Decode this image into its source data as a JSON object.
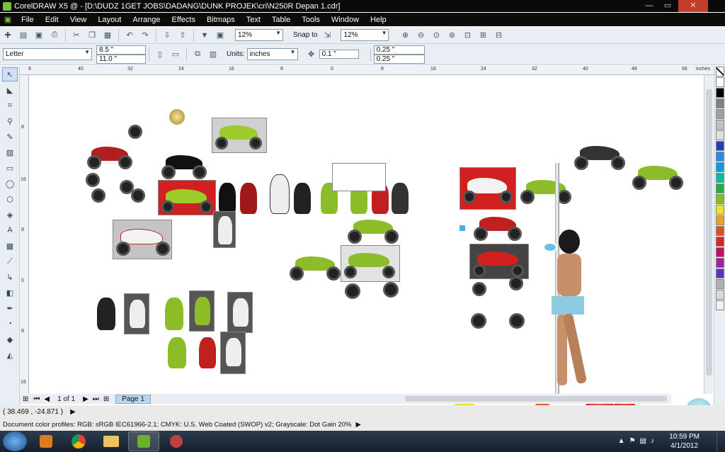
{
  "window": {
    "title": "CorelDRAW X5 @ - [D:\\DUDZ 1GET JOBS\\DADANG\\DUNK PROJEK\\cri\\N250R Depan 1.cdr]",
    "minimize": "—",
    "maximize": "▭",
    "close": "✕"
  },
  "menu": [
    "File",
    "Edit",
    "View",
    "Layout",
    "Arrange",
    "Effects",
    "Bitmaps",
    "Text",
    "Table",
    "Tools",
    "Window",
    "Help"
  ],
  "standard_toolbar": {
    "zoom_value": "12%",
    "snap_to_label": "Snap to",
    "zoom_value_2": "12%"
  },
  "property_bar": {
    "page_size": "Letter",
    "width": "8.5 \"",
    "height": "11.0 \"",
    "units_label": "Units:",
    "units_value": "inches",
    "nudge": "0.1 \"",
    "dup_x": "0.25 \"",
    "dup_y": "0.25 \""
  },
  "ruler": {
    "h_ticks": [
      "8",
      "40",
      "32",
      "24",
      "16",
      "8",
      "0",
      "8",
      "16",
      "24",
      "32",
      "40",
      "48",
      "56"
    ],
    "unit_label": "inches",
    "v_ticks": [
      "8",
      "16",
      "8",
      "0",
      "8",
      "16"
    ]
  },
  "page_nav": {
    "page_count": "1 of 1",
    "page_tab": "Page 1"
  },
  "status": {
    "coordinates": "( 38.469 , -24.871 )",
    "color_profiles": "Document color profiles: RGB: sRGB IEC61966-2.1; CMYK: U.S. Web Coated (SWOP) v2; Grayscale: Dot Gain 20%"
  },
  "taskbar": {
    "time": "10:59 PM",
    "date": "4/1/2012"
  },
  "palette_colors": [
    "#ffffff",
    "#000000",
    "#808080",
    "#a0a0a0",
    "#c0c0c0",
    "#e0e0e0",
    "#1f3fc0",
    "#2b8be0",
    "#00a0e0",
    "#00c0a0",
    "#20b040",
    "#80c020",
    "#f0e020",
    "#f0a020",
    "#e05020",
    "#e02020",
    "#c01060",
    "#a020a0",
    "#6030c0",
    "#b0b0b0",
    "#d8d8d8",
    "#f0f0f0"
  ],
  "icons": {
    "pointer": "pick-tool-icon",
    "shape": "shape-tool-icon",
    "crop": "crop-tool-icon",
    "zoom": "zoom-tool-icon",
    "freehand": "freehand-tool-icon",
    "rect": "rectangle-tool-icon",
    "ellipse": "ellipse-tool-icon",
    "polygon": "polygon-tool-icon",
    "text": "text-tool-icon"
  }
}
